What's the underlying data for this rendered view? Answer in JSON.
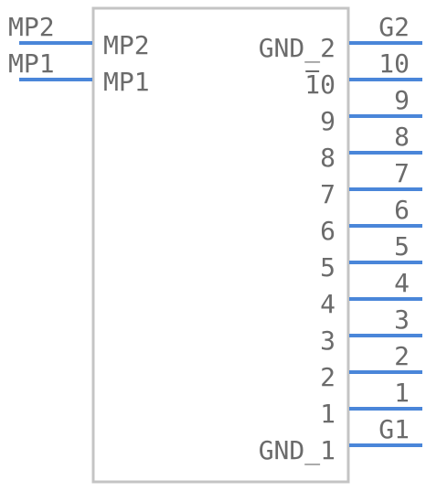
{
  "colors": {
    "body_stroke": "#c4c4c4",
    "pin": "#4a86d9",
    "text": "#6b6b6b",
    "background": "#ffffff"
  },
  "left_pins": [
    {
      "pin_label": "MP2",
      "name": "MP2"
    },
    {
      "pin_label": "MP1",
      "name": "MP1"
    }
  ],
  "right_pins": [
    {
      "pin_label": "G2",
      "name": "GND_2"
    },
    {
      "pin_label": "10",
      "name": "10"
    },
    {
      "pin_label": "9",
      "name": "9"
    },
    {
      "pin_label": "8",
      "name": "8"
    },
    {
      "pin_label": "7",
      "name": "7"
    },
    {
      "pin_label": "6",
      "name": "6"
    },
    {
      "pin_label": "5",
      "name": "5"
    },
    {
      "pin_label": "4",
      "name": "4"
    },
    {
      "pin_label": "3",
      "name": "3"
    },
    {
      "pin_label": "2",
      "name": "2"
    },
    {
      "pin_label": "1",
      "name": "1"
    },
    {
      "pin_label": "G1",
      "name": "GND_1"
    }
  ]
}
